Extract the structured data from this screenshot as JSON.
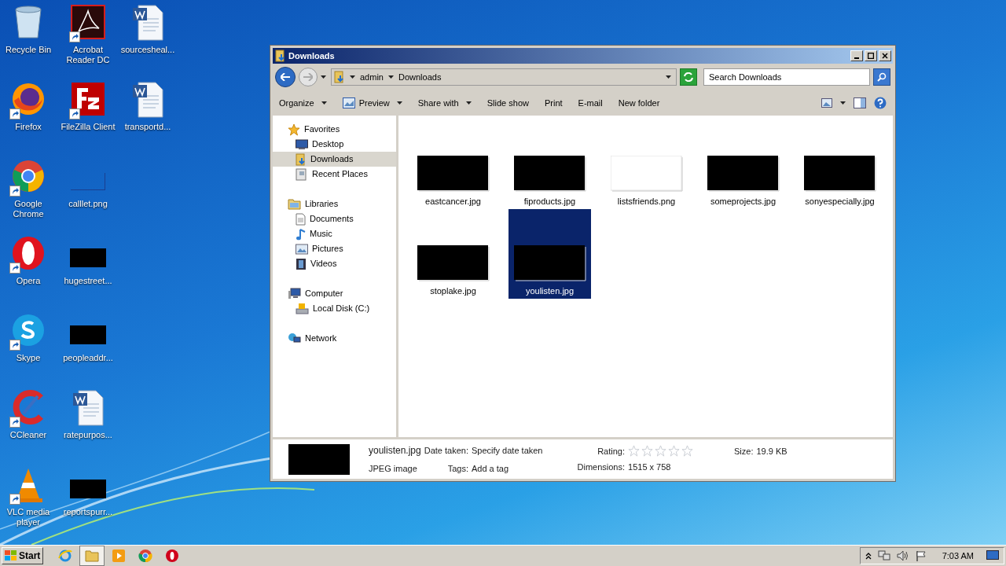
{
  "desktop_icons": [
    {
      "label": "Recycle Bin",
      "kind": "recycle",
      "shortcut": false
    },
    {
      "label": "Firefox",
      "kind": "firefox",
      "shortcut": true
    },
    {
      "label": "Google Chrome",
      "kind": "chrome",
      "shortcut": true
    },
    {
      "label": "Opera",
      "kind": "opera",
      "shortcut": true
    },
    {
      "label": "Skype",
      "kind": "skype",
      "shortcut": true
    },
    {
      "label": "CCleaner",
      "kind": "ccleaner",
      "shortcut": true
    },
    {
      "label": "VLC media player",
      "kind": "vlc",
      "shortcut": true
    },
    {
      "label": "Acrobat Reader DC",
      "kind": "acrobat",
      "shortcut": true
    },
    {
      "label": "FileZilla Client",
      "kind": "filezilla",
      "shortcut": true
    },
    {
      "label": "calllet.png",
      "kind": "blank-image",
      "shortcut": false
    },
    {
      "label": "hugestreet...",
      "kind": "image",
      "shortcut": false
    },
    {
      "label": "peopleaddr...",
      "kind": "image",
      "shortcut": false
    },
    {
      "label": "ratepurpos...",
      "kind": "word",
      "shortcut": false
    },
    {
      "label": "reportspurr...",
      "kind": "image",
      "shortcut": false
    },
    {
      "label": "sourcesheal...",
      "kind": "word",
      "shortcut": false
    },
    {
      "label": "transportd...",
      "kind": "word",
      "shortcut": false
    }
  ],
  "window": {
    "title": "Downloads",
    "breadcrumb": [
      "admin",
      "Downloads"
    ],
    "search": {
      "placeholder": "Search Downloads"
    },
    "commands": [
      {
        "label": "Organize",
        "dropdown": true,
        "icon": false
      },
      {
        "label": "Preview",
        "dropdown": true,
        "icon": true
      },
      {
        "label": "Share with",
        "dropdown": true,
        "icon": false
      },
      {
        "label": "Slide show",
        "dropdown": false,
        "icon": false
      },
      {
        "label": "Print",
        "dropdown": false,
        "icon": false
      },
      {
        "label": "E-mail",
        "dropdown": false,
        "icon": false
      },
      {
        "label": "New folder",
        "dropdown": false,
        "icon": false
      }
    ],
    "nav": [
      {
        "label": "Favorites",
        "kind": "favorites",
        "selected": false,
        "children": [
          {
            "label": "Desktop",
            "kind": "desktop",
            "selected": false
          },
          {
            "label": "Downloads",
            "kind": "downloads",
            "selected": true
          },
          {
            "label": "Recent Places",
            "kind": "recent",
            "selected": false
          }
        ]
      },
      {
        "label": "Libraries",
        "kind": "libraries",
        "selected": false,
        "children": [
          {
            "label": "Documents",
            "kind": "documents",
            "selected": false
          },
          {
            "label": "Music",
            "kind": "music",
            "selected": false
          },
          {
            "label": "Pictures",
            "kind": "pictures",
            "selected": false
          },
          {
            "label": "Videos",
            "kind": "videos",
            "selected": false
          }
        ]
      },
      {
        "label": "Computer",
        "kind": "computer",
        "selected": false,
        "children": [
          {
            "label": "Local Disk (C:)",
            "kind": "disk",
            "selected": false
          }
        ]
      },
      {
        "label": "Network",
        "kind": "network",
        "selected": false
      }
    ],
    "files": [
      {
        "name": "eastcancer.jpg",
        "kind": "dark",
        "selected": false
      },
      {
        "name": "fiproducts.jpg",
        "kind": "dark",
        "selected": false
      },
      {
        "name": "listsfriends.png",
        "kind": "light",
        "selected": false
      },
      {
        "name": "someprojects.jpg",
        "kind": "dark",
        "selected": false
      },
      {
        "name": "sonyespecially.jpg",
        "kind": "dark",
        "selected": false
      },
      {
        "name": "stoplake.jpg",
        "kind": "dark",
        "selected": false
      },
      {
        "name": "youlisten.jpg",
        "kind": "dark",
        "selected": true
      }
    ],
    "details": {
      "name": "youlisten.jpg",
      "type": "JPEG image",
      "fields": [
        {
          "label": "Date taken:",
          "value": "Specify date taken"
        },
        {
          "label": "Tags:",
          "value": "Add a tag"
        }
      ],
      "rating_label": "Rating:",
      "stars": 0,
      "dimensions_label": "Dimensions:",
      "dimensions": "1515 x 758",
      "size_label": "Size:",
      "size": "19.9 KB"
    }
  },
  "taskbar": {
    "start": "Start",
    "apps": [
      {
        "kind": "ie",
        "selected": false
      },
      {
        "kind": "explorer",
        "selected": true
      },
      {
        "kind": "media",
        "selected": false
      },
      {
        "kind": "chrome",
        "selected": false
      },
      {
        "kind": "opera",
        "selected": false
      }
    ],
    "clock": "7:03 AM"
  }
}
